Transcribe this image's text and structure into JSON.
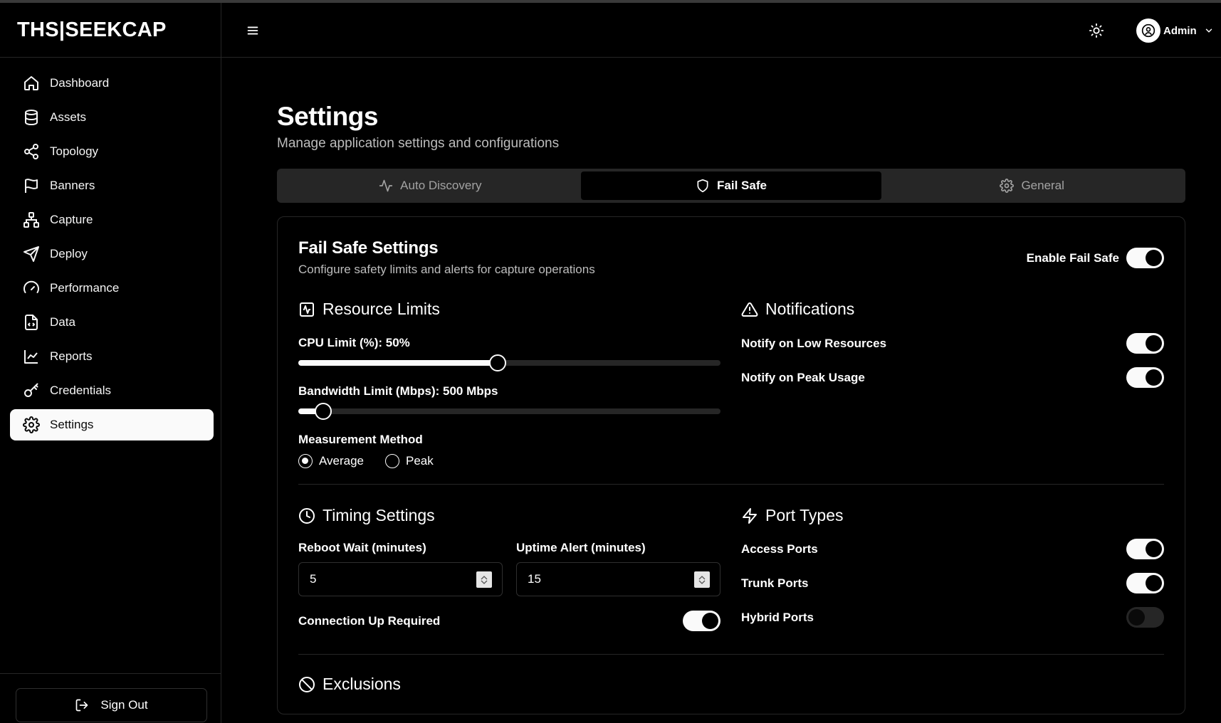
{
  "brand": "THS|SEEKCAP",
  "sidebar": {
    "items": [
      {
        "label": "Dashboard",
        "icon": "home-icon"
      },
      {
        "label": "Assets",
        "icon": "database-icon"
      },
      {
        "label": "Topology",
        "icon": "share-icon"
      },
      {
        "label": "Banners",
        "icon": "flag-icon"
      },
      {
        "label": "Capture",
        "icon": "network-icon"
      },
      {
        "label": "Deploy",
        "icon": "send-icon"
      },
      {
        "label": "Performance",
        "icon": "gauge-icon"
      },
      {
        "label": "Data",
        "icon": "file-code-icon"
      },
      {
        "label": "Reports",
        "icon": "line-chart-icon"
      },
      {
        "label": "Credentials",
        "icon": "key-icon"
      },
      {
        "label": "Settings",
        "icon": "gear-icon",
        "active": true
      }
    ],
    "signout_label": "Sign Out"
  },
  "header": {
    "user_name": "Admin"
  },
  "page": {
    "title": "Settings",
    "subtitle": "Manage application settings and configurations"
  },
  "tabs": [
    {
      "label": "Auto Discovery",
      "icon": "activity-icon"
    },
    {
      "label": "Fail Safe",
      "icon": "shield-icon",
      "active": true
    },
    {
      "label": "General",
      "icon": "gear-icon"
    }
  ],
  "failsafe": {
    "title": "Fail Safe Settings",
    "subtitle": "Configure safety limits and alerts for capture operations",
    "enable_label": "Enable Fail Safe",
    "enabled": true,
    "resource_limits": {
      "title": "Resource Limits",
      "cpu_label": "CPU Limit (%): 50%",
      "cpu_fraction": 0.472,
      "bandwidth_label": "Bandwidth Limit (Mbps): 500 Mbps",
      "bandwidth_fraction": 0.059,
      "method_label": "Measurement Method",
      "methods": [
        {
          "label": "Average",
          "selected": true
        },
        {
          "label": "Peak",
          "selected": false
        }
      ]
    },
    "notifications": {
      "title": "Notifications",
      "items": [
        {
          "label": "Notify on Low Resources",
          "on": true
        },
        {
          "label": "Notify on Peak Usage",
          "on": true
        }
      ]
    },
    "timing": {
      "title": "Timing Settings",
      "reboot_label": "Reboot Wait (minutes)",
      "reboot_value": "5",
      "uptime_label": "Uptime Alert (minutes)",
      "uptime_value": "15",
      "connection_label": "Connection Up Required",
      "connection_on": true
    },
    "port_types": {
      "title": "Port Types",
      "items": [
        {
          "label": "Access Ports",
          "on": true
        },
        {
          "label": "Trunk Ports",
          "on": true
        },
        {
          "label": "Hybrid Ports",
          "on": false
        }
      ]
    },
    "exclusions": {
      "title": "Exclusions"
    }
  }
}
